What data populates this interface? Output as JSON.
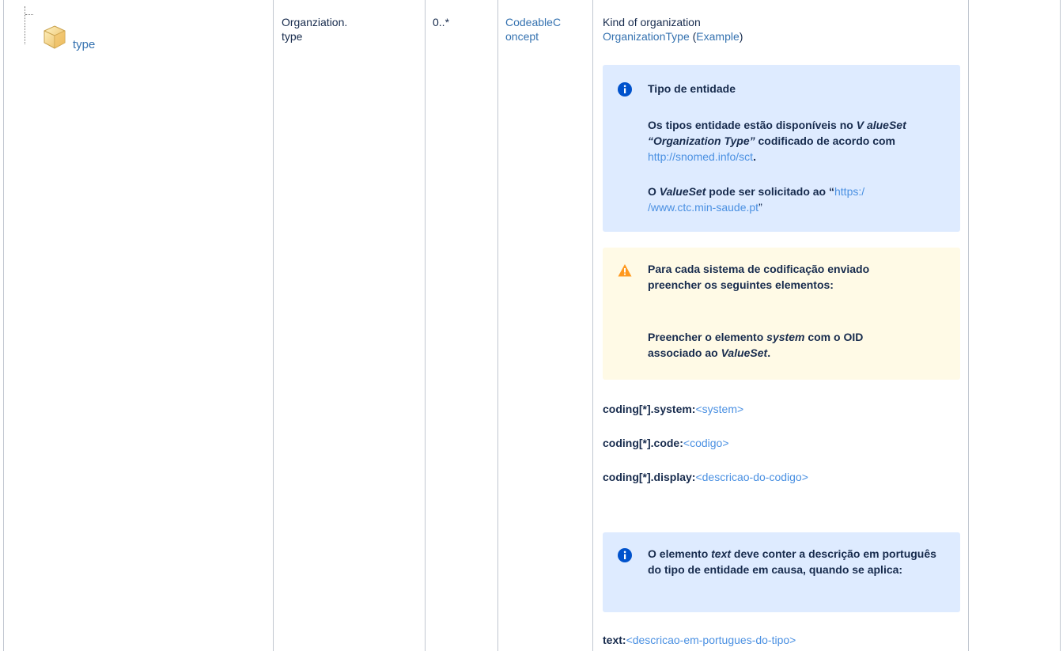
{
  "row": {
    "name": {
      "icon": "element-cube-icon",
      "label": "type"
    },
    "path": {
      "line1": "Organziation.",
      "line2": "type"
    },
    "cardinality": "0..*",
    "datatype": {
      "line1": "CodeableC",
      "line2": "oncept"
    },
    "description": {
      "title": "Kind of organization",
      "binding_link": "OrganizationType",
      "binding_open": " (",
      "binding_strength": "Example",
      "binding_close": ")"
    },
    "info_panel_1": {
      "icon": "info-icon",
      "heading": "Tipo de entidade",
      "p1_a": "Os tipos entidade estão disponíveis no ",
      "p1_b": "V alueSet “Organization Type”",
      "p1_c": " codificado de acordo com ",
      "p1_link": "http://snomed.info/sct",
      "p1_d": ".",
      "p2_a": "O ",
      "p2_b": "ValueSet",
      "p2_c": " pode ser solicitado ao “",
      "p2_link_1": "https:/",
      "p2_link_2": "/www.ctc.min-saude.pt",
      "p2_d": "”"
    },
    "warn_panel": {
      "icon": "warning-icon",
      "p1": "Para cada sistema de codificação enviado preencher os seguintes elementos:",
      "p2_a": "Preencher o elemento ",
      "p2_b": "system",
      "p2_c": " com o OID associado ao ",
      "p2_d": "ValueSet",
      "p2_e": "."
    },
    "code_lines": [
      {
        "key": "coding[*].system:",
        "value": "<system>"
      },
      {
        "key": "coding[*].code:",
        "value": "<codigo>"
      },
      {
        "key": "coding[*].display:",
        "value": "<descricao-do-codigo>"
      }
    ],
    "info_panel_2": {
      "icon": "info-icon",
      "a": "O elemento ",
      "b": "text",
      "c": " deve conter a descrição em português do tipo de entidade em causa, quando se aplica:"
    },
    "text_line": {
      "key": "text:",
      "value": "<descricao-em-portugues-do-tipo>"
    }
  },
  "colors": {
    "link": "#3572b0",
    "info_bg": "#deebff",
    "warn_bg": "#fffae6",
    "info_icon": "#0052cc",
    "warn_icon": "#ff991f",
    "border": "#c1c7d0"
  }
}
